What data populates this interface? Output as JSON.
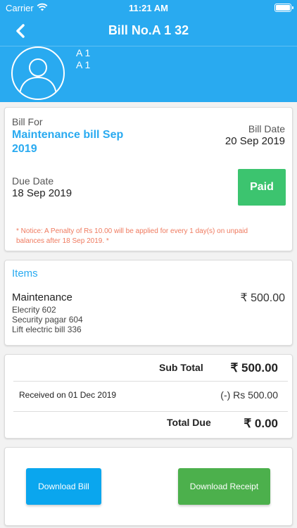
{
  "status_bar": {
    "carrier": "Carrier",
    "time": "11:21 AM"
  },
  "nav": {
    "title": "Bill No.A 1 32",
    "back_icon": "chevron-left-icon"
  },
  "member": {
    "line1": "A 1",
    "line2": "A 1",
    "avatar_icon": "user-avatar-icon"
  },
  "bill": {
    "bill_for_label": "Bill For",
    "bill_for_value_line1": "Maintenance bill Sep",
    "bill_for_value_line2": "2019",
    "bill_date_label": "Bill Date",
    "bill_date_value": "20 Sep 2019",
    "due_date_label": "Due Date",
    "due_date_value": "18 Sep 2019",
    "status": "Paid",
    "notice_line1": "* Notice: A Penalty of Rs 10.00 will be applied for every 1 day(s) on unpaid",
    "notice_line2": "balances after 18 Sep 2019. *"
  },
  "items": {
    "title": "Items",
    "list": [
      {
        "name": "Maintenance",
        "amount": "₹ 500.00",
        "sub_items": [
          "Elecrity 602",
          "Security pagar 604",
          "Lift electric bill 336"
        ]
      }
    ]
  },
  "summary": {
    "sub_total_label": "Sub Total",
    "sub_total_value": "₹ 500.00",
    "received_label": "Received on 01 Dec 2019",
    "received_value": "(-) Rs 500.00",
    "total_due_label": "Total Due",
    "total_due_value": "₹ 0.00"
  },
  "actions": {
    "download_bill": "Download Bill",
    "download_receipt": "Download Receipt"
  },
  "colors": {
    "header": "#29aaf0",
    "accent_text": "#29aaf0",
    "paid": "#3cc46f",
    "notice": "#ef7a5f",
    "bill_button": "#0aa6ee",
    "receipt_button": "#4cb04c"
  }
}
